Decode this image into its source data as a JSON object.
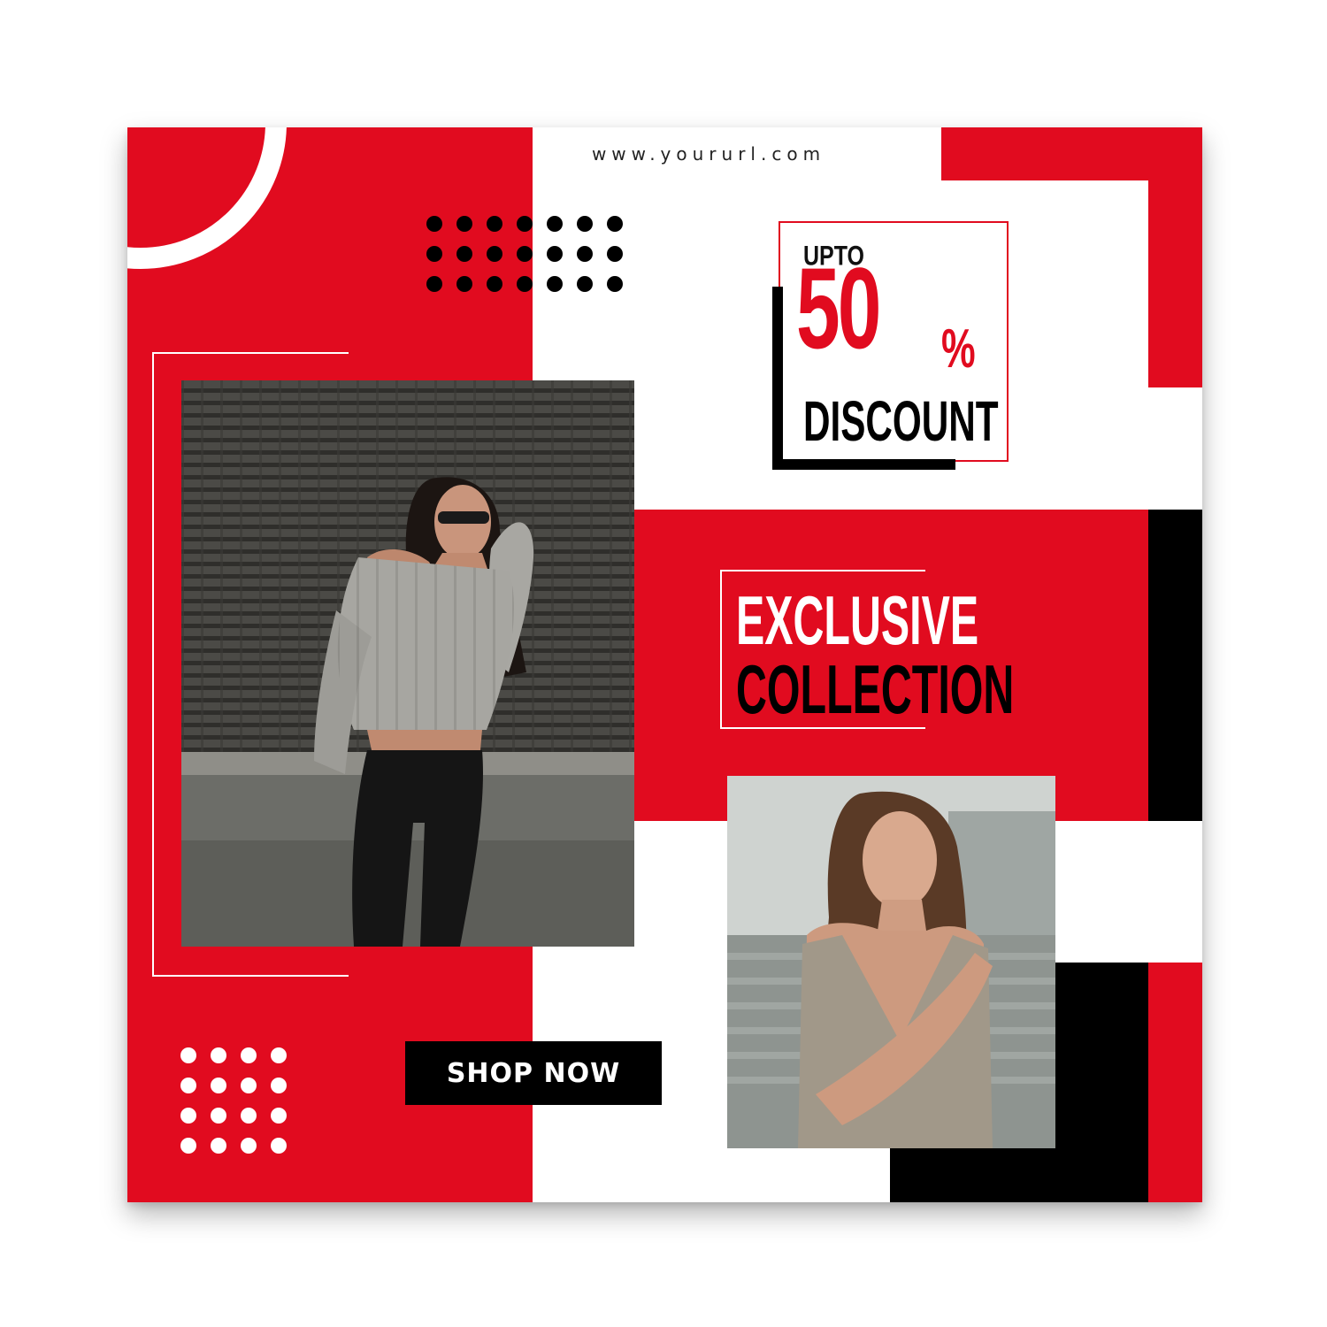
{
  "banner": {
    "url": "www.yoururl.com",
    "discount": {
      "prefix": "UPTO",
      "number": "50",
      "percent_sign": "%",
      "word": "DISCOUNT"
    },
    "headline": {
      "line1": "EXCLUSIVE",
      "line2": "COLLECTION"
    },
    "cta_label": "SHOP NOW",
    "colors": {
      "accent": "#e10b1f",
      "dark": "#000000",
      "light": "#ffffff"
    },
    "icons": [
      "dot-grid-black",
      "dot-grid-white",
      "ring-decoration"
    ]
  }
}
